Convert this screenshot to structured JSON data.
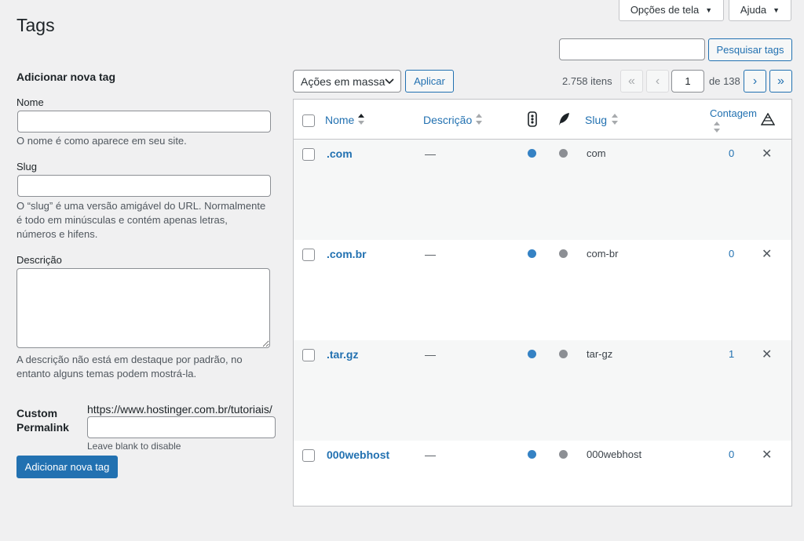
{
  "header": {
    "title": "Tags",
    "screen_options_label": "Opções de tela",
    "help_label": "Ajuda"
  },
  "search": {
    "value": "",
    "button_label": "Pesquisar tags"
  },
  "form": {
    "heading": "Adicionar nova tag",
    "name_label": "Nome",
    "name_value": "",
    "name_help": "O nome é como aparece em seu site.",
    "slug_label": "Slug",
    "slug_value": "",
    "slug_help_lines": [
      "O “slug” é uma versão amigável do URL. Normalmente",
      "é todo em minúsculas e contém apenas letras,",
      "números e hifens."
    ],
    "description_label": "Descrição",
    "description_value": "",
    "description_help_lines": [
      "A descrição não está em destaque por padrão, no",
      "entanto alguns temas podem mostrá-la."
    ],
    "custom_permalink_label_lines": [
      "Custom",
      "Permalink"
    ],
    "permalink_base": "https://www.hostinger.com.br/tutoriais/",
    "permalink_value": "",
    "permalink_help": "Leave blank to disable",
    "submit_label": "Adicionar nova tag"
  },
  "bulk": {
    "selected": "Ações em massa",
    "apply_label": "Aplicar"
  },
  "pagination": {
    "items_count": "2.758 itens",
    "first": "«",
    "prev": "‹",
    "current_page": "1",
    "of_total": "de 138",
    "next": "›",
    "last": "»"
  },
  "table": {
    "columns": {
      "name": "Nome",
      "description": "Descrição",
      "slug": "Slug",
      "count": "Contagem"
    },
    "rows": [
      {
        "name": ".com",
        "description": "—",
        "slug": "com",
        "count": "0"
      },
      {
        "name": ".com.br",
        "description": "—",
        "slug": "com-br",
        "count": "0"
      },
      {
        "name": ".tar.gz",
        "description": "—",
        "slug": "tar-gz",
        "count": "1"
      },
      {
        "name": "000webhost",
        "description": "—",
        "slug": "000webhost",
        "count": "0"
      }
    ]
  },
  "icons": {
    "traffic_light": "traffic-light-icon",
    "feather": "feather-icon",
    "pyramid": "pyramid-icon",
    "delete": "close-icon"
  },
  "colors": {
    "accent": "#2271b1",
    "dot_blue": "#3582c4",
    "dot_grey": "#8c8f94",
    "background": "#f0f0f1"
  }
}
